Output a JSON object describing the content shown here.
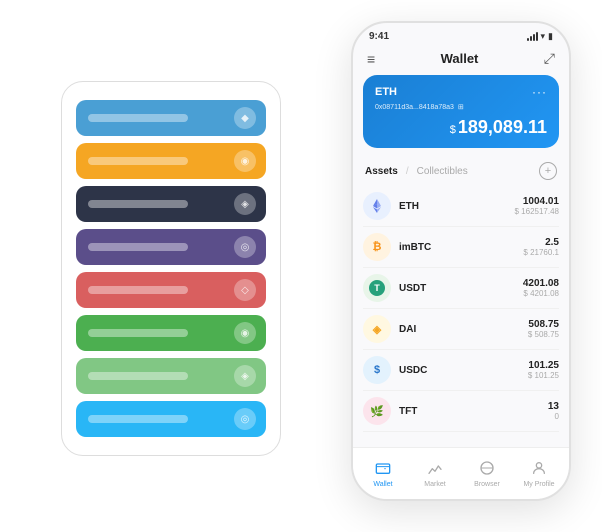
{
  "scene": {
    "card_stack": {
      "cards": [
        {
          "id": "card-blue",
          "color": "#4a9fd4",
          "icon": "◆"
        },
        {
          "id": "card-orange",
          "color": "#f5a623",
          "icon": "◉"
        },
        {
          "id": "card-dark",
          "color": "#2d3448",
          "icon": "◈"
        },
        {
          "id": "card-purple",
          "color": "#5b4e8a",
          "icon": "◎"
        },
        {
          "id": "card-red",
          "color": "#d95f5f",
          "icon": "◇"
        },
        {
          "id": "card-green",
          "color": "#4caf50",
          "icon": "◉"
        },
        {
          "id": "card-light-green",
          "color": "#81c784",
          "icon": "◈"
        },
        {
          "id": "card-teal",
          "color": "#29b6f6",
          "icon": "◎"
        }
      ]
    },
    "phone": {
      "status_bar": {
        "time": "9:41",
        "wifi": "WiFi",
        "battery": "Battery"
      },
      "header": {
        "menu_icon": "≡",
        "title": "Wallet",
        "expand_icon": "⤢"
      },
      "eth_card": {
        "label": "ETH",
        "more_icon": "···",
        "address": "0x08711d3a...8418a78a3",
        "address_suffix": "⊞",
        "balance_symbol": "$",
        "balance": "189,089.11"
      },
      "assets_tabs": {
        "tab_active": "Assets",
        "tab_divider": "/",
        "tab_inactive": "Collectibles",
        "add_icon": "+"
      },
      "asset_list": [
        {
          "symbol": "ETH",
          "icon_emoji": "⬡",
          "icon_bg": "#e8f0fe",
          "icon_color": "#3f51b5",
          "amount": "1004.01",
          "usd": "$ 162517.48"
        },
        {
          "symbol": "imBTC",
          "icon_emoji": "₿",
          "icon_bg": "#fff3e0",
          "icon_color": "#f57c00",
          "amount": "2.5",
          "usd": "$ 21760.1"
        },
        {
          "symbol": "USDT",
          "icon_emoji": "T",
          "icon_bg": "#e8f5e9",
          "icon_color": "#2e7d32",
          "amount": "4201.08",
          "usd": "$ 4201.08"
        },
        {
          "symbol": "DAI",
          "icon_emoji": "◈",
          "icon_bg": "#fff8e1",
          "icon_color": "#f9a825",
          "amount": "508.75",
          "usd": "$ 508.75"
        },
        {
          "symbol": "USDC",
          "icon_emoji": "$",
          "icon_bg": "#e3f2fd",
          "icon_color": "#1565c0",
          "amount": "101.25",
          "usd": "$ 101.25"
        },
        {
          "symbol": "TFT",
          "icon_emoji": "🌿",
          "icon_bg": "#fce4ec",
          "icon_color": "#c62828",
          "amount": "13",
          "usd": "0"
        }
      ],
      "bottom_nav": [
        {
          "id": "wallet",
          "label": "Wallet",
          "icon": "◎",
          "active": true
        },
        {
          "id": "market",
          "label": "Market",
          "icon": "↗",
          "active": false
        },
        {
          "id": "browser",
          "label": "Browser",
          "icon": "⊕",
          "active": false
        },
        {
          "id": "profile",
          "label": "My Profile",
          "icon": "👤",
          "active": false
        }
      ]
    }
  }
}
